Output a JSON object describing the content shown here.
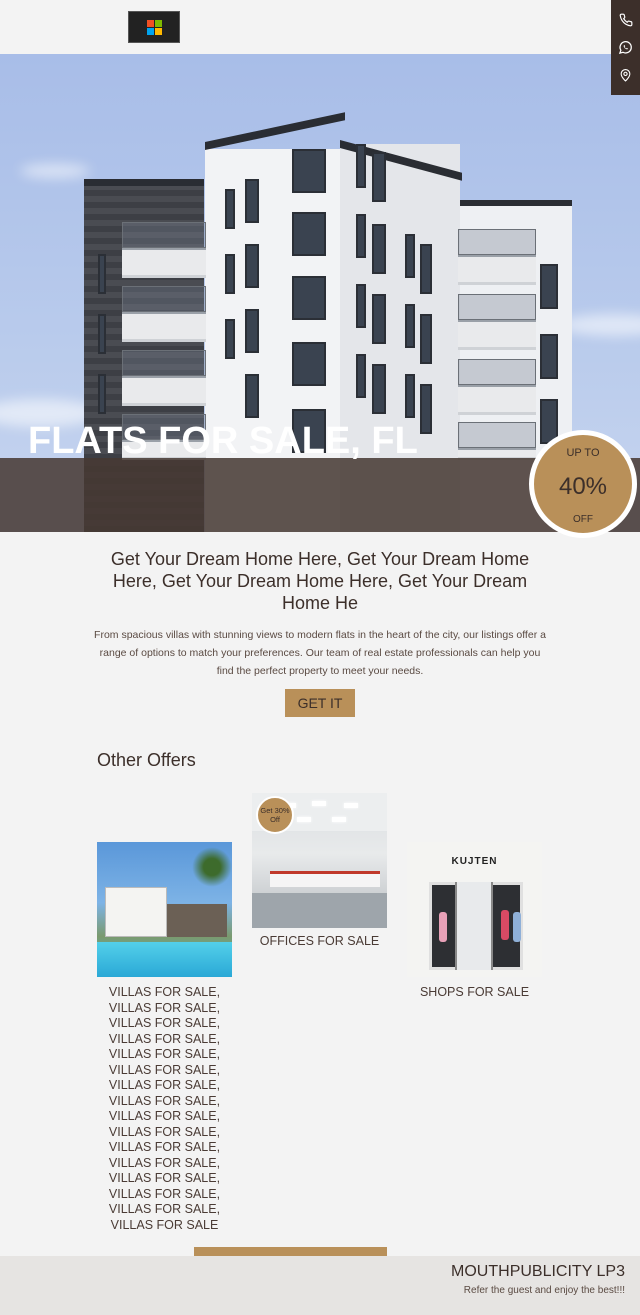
{
  "header": {
    "logo": "windows-logo",
    "contacts": [
      {
        "icon": "phone-icon"
      },
      {
        "icon": "whatsapp-icon"
      },
      {
        "icon": "location-pin-icon"
      }
    ]
  },
  "hero": {
    "title": "FLATS FOR SALE, FL",
    "badge": {
      "top": "UP TO",
      "value": "40%",
      "bottom": "OFF"
    }
  },
  "intro": {
    "heading": "Get Your Dream Home Here, Get Your Dream Home Here, Get Your Dream Home Here, Get Your Dream Home He",
    "text": "From spacious villas with stunning views to modern flats in the heart of the city, our listings offer a range of options to match your preferences. Our team of real estate professionals can help you find the perfect property to meet your needs.",
    "cta": "GET IT"
  },
  "offers": {
    "title": "Other Offers",
    "villas": {
      "label": "VILLAS FOR SALE, VILLAS FOR SALE, VILLAS FOR SALE, VILLAS FOR SALE, VILLAS FOR SALE, VILLAS FOR SALE, VILLAS FOR SALE, VILLAS FOR SALE, VILLAS FOR SALE, VILLAS FOR SALE, VILLAS FOR SALE, VILLAS FOR SALE, VILLAS FOR SALE, VILLAS FOR SALE, VILLAS FOR SALE, VILLAS FOR SALE"
    },
    "offices": {
      "label": "OFFICES FOR SALE",
      "badge": "Get 30% Off"
    },
    "shops": {
      "label": "SHOPS FOR SALE",
      "sign": "KUJTEN"
    }
  },
  "footer": {
    "title": "MOUTHPUBLICITY LP3",
    "subtitle": "Refer the guest and enjoy the best!!!"
  },
  "colors": {
    "accent": "#b99059",
    "dark": "#3c2f2a",
    "background": "#f3f3f3"
  }
}
